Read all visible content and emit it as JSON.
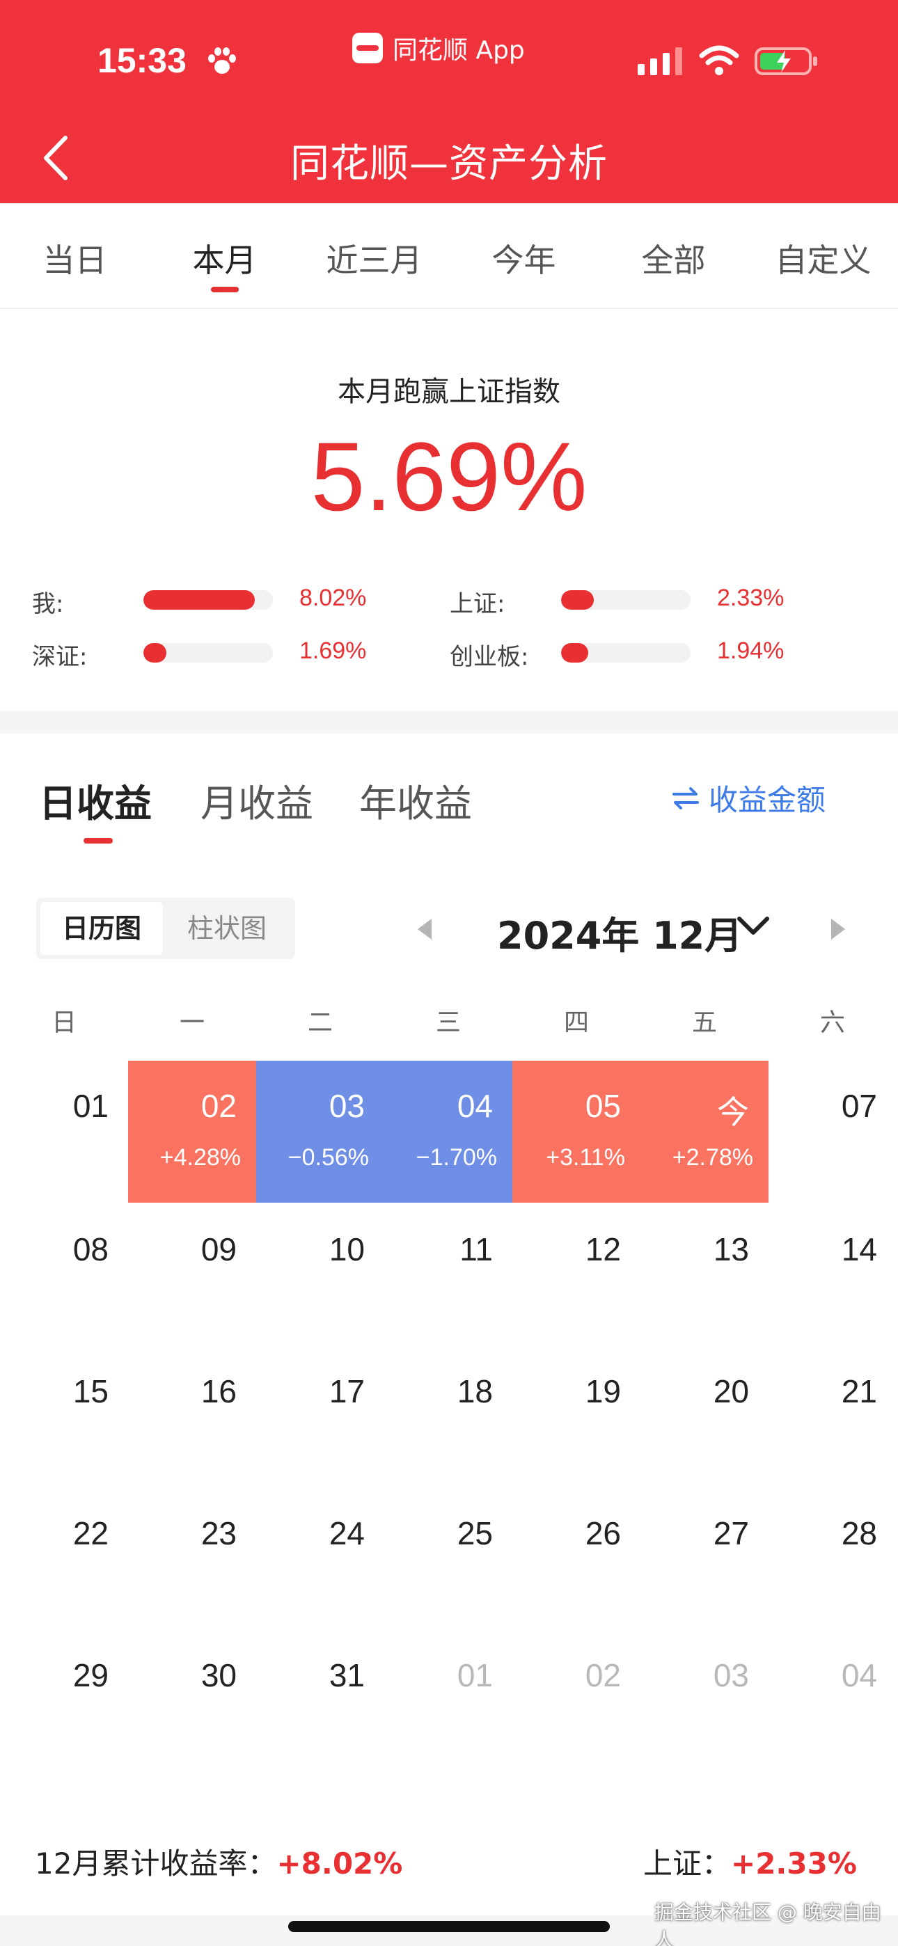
{
  "status_bar": {
    "time": "15:33",
    "app_name": "同花顺 App"
  },
  "header": {
    "title": "同花顺—资产分析",
    "back_icon": "chevron-left-icon"
  },
  "period_tabs": [
    {
      "label": "当日",
      "active": false
    },
    {
      "label": "本月",
      "active": true
    },
    {
      "label": "近三月",
      "active": false
    },
    {
      "label": "今年",
      "active": false
    },
    {
      "label": "全部",
      "active": false
    },
    {
      "label": "自定义",
      "active": false
    }
  ],
  "summary": {
    "title": "本月跑赢上证指数",
    "value": "5.69%",
    "comparisons": [
      {
        "label": "我:",
        "value": "8.02%",
        "level": 0.86
      },
      {
        "label": "上证:",
        "value": "2.33%",
        "level": 0.25
      },
      {
        "label": "深证:",
        "value": "1.69%",
        "level": 0.18
      },
      {
        "label": "创业板:",
        "value": "1.94%",
        "level": 0.21
      }
    ]
  },
  "income_tabs": [
    {
      "label": "日收益",
      "active": true
    },
    {
      "label": "月收益",
      "active": false
    },
    {
      "label": "年收益",
      "active": false
    }
  ],
  "amount_toggle": {
    "label": "收益金额",
    "icon": "swap-arrows-icon"
  },
  "view_toggle": {
    "calendar": "日历图",
    "bar": "柱状图"
  },
  "month_picker": {
    "label": "2024年 12月"
  },
  "weekdays": [
    "日",
    "一",
    "二",
    "三",
    "四",
    "五",
    "六"
  ],
  "calendar_rows": [
    [
      {
        "day": "01"
      },
      {
        "day": "02",
        "ret": "+4.28%",
        "type": "gain"
      },
      {
        "day": "03",
        "ret": "−0.56%",
        "type": "loss"
      },
      {
        "day": "04",
        "ret": "−1.70%",
        "type": "loss"
      },
      {
        "day": "05",
        "ret": "+3.11%",
        "type": "gain"
      },
      {
        "day": "今",
        "ret": "+2.78%",
        "type": "gain"
      },
      {
        "day": "07"
      }
    ],
    [
      {
        "day": "08"
      },
      {
        "day": "09"
      },
      {
        "day": "10"
      },
      {
        "day": "11"
      },
      {
        "day": "12"
      },
      {
        "day": "13"
      },
      {
        "day": "14"
      }
    ],
    [
      {
        "day": "15"
      },
      {
        "day": "16"
      },
      {
        "day": "17"
      },
      {
        "day": "18"
      },
      {
        "day": "19"
      },
      {
        "day": "20"
      },
      {
        "day": "21"
      }
    ],
    [
      {
        "day": "22"
      },
      {
        "day": "23"
      },
      {
        "day": "24"
      },
      {
        "day": "25"
      },
      {
        "day": "26"
      },
      {
        "day": "27"
      },
      {
        "day": "28"
      }
    ],
    [
      {
        "day": "29"
      },
      {
        "day": "30"
      },
      {
        "day": "31"
      },
      {
        "day": "01",
        "muted": true
      },
      {
        "day": "02",
        "muted": true
      },
      {
        "day": "03",
        "muted": true
      },
      {
        "day": "04",
        "muted": true
      }
    ]
  ],
  "footer": {
    "cumulative_label": "12月累计收益率：",
    "cumulative_value": "+8.02%",
    "index_label": "上证：",
    "index_value": "+2.33%"
  },
  "watermark": "掘金技术社区 @ 晚安自由人",
  "colors": {
    "brand_red": "#f0323c",
    "gain": "#fa7361",
    "loss": "#6f8fe6",
    "link_blue": "#3d7be8"
  }
}
